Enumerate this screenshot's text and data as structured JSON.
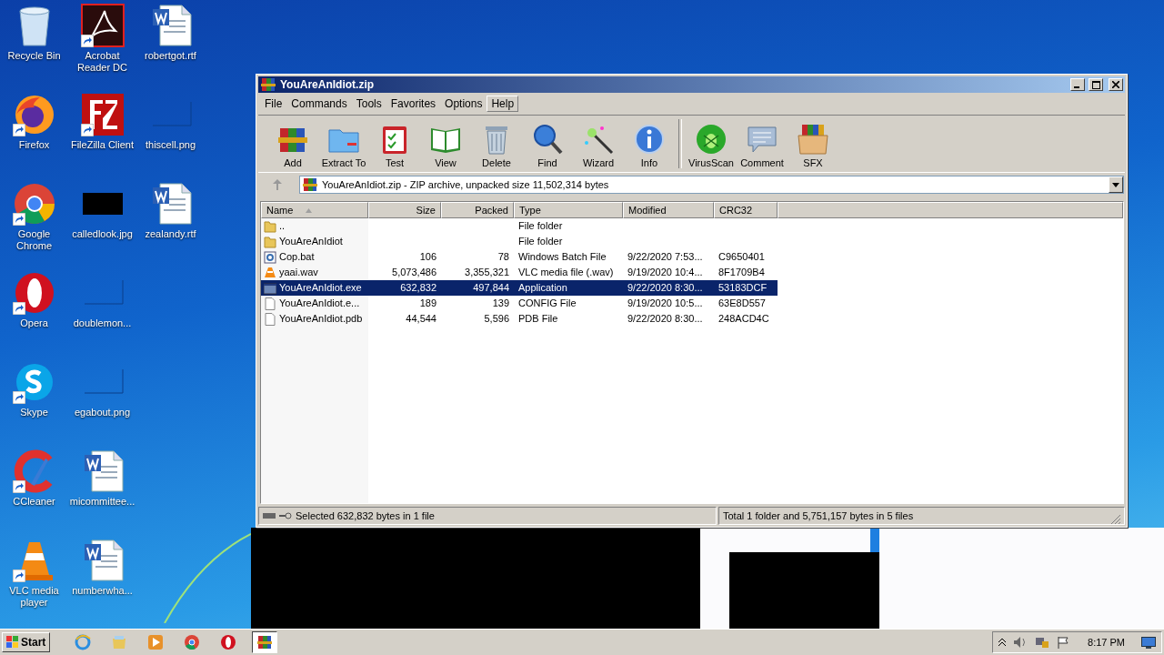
{
  "desktop": {
    "icons": [
      {
        "label": "Recycle Bin",
        "kind": "recycle",
        "shortcut": false
      },
      {
        "label": "Firefox",
        "kind": "firefox",
        "shortcut": true
      },
      {
        "label": "Google Chrome",
        "kind": "chrome",
        "shortcut": true
      },
      {
        "label": "Opera",
        "kind": "opera",
        "shortcut": true
      },
      {
        "label": "Skype",
        "kind": "skype",
        "shortcut": true
      },
      {
        "label": "CCleaner",
        "kind": "ccleaner",
        "shortcut": true
      },
      {
        "label": "VLC media player",
        "kind": "vlc",
        "shortcut": true
      },
      {
        "label": "Acrobat Reader DC",
        "kind": "acrobat",
        "shortcut": true
      },
      {
        "label": "FileZilla Client",
        "kind": "filezilla",
        "shortcut": true
      },
      {
        "label": "calledlook.jpg",
        "kind": "dark-image",
        "shortcut": false
      },
      {
        "label": "doublemon...",
        "kind": "blank-image",
        "shortcut": false
      },
      {
        "label": "egabout.png",
        "kind": "blank-image",
        "shortcut": false
      },
      {
        "label": "micommittee...",
        "kind": "word",
        "shortcut": false
      },
      {
        "label": "numberwha...",
        "kind": "word",
        "shortcut": false
      },
      {
        "label": "robertgot.rtf",
        "kind": "word",
        "shortcut": false
      },
      {
        "label": "thiscell.png",
        "kind": "blank-image",
        "shortcut": false
      },
      {
        "label": "zealandy.rtf",
        "kind": "word",
        "shortcut": false
      }
    ]
  },
  "window": {
    "title": "YouAreAnIdiot.zip",
    "menu": [
      {
        "label": "File",
        "selected": false
      },
      {
        "label": "Commands",
        "selected": false
      },
      {
        "label": "Tools",
        "selected": false
      },
      {
        "label": "Favorites",
        "selected": false
      },
      {
        "label": "Options",
        "selected": false
      },
      {
        "label": "Help",
        "selected": true
      }
    ],
    "toolbar": [
      {
        "kind": "button",
        "label": "Add"
      },
      {
        "kind": "button",
        "label": "Extract To"
      },
      {
        "kind": "button",
        "label": "Test"
      },
      {
        "kind": "button",
        "label": "View"
      },
      {
        "kind": "button",
        "label": "Delete"
      },
      {
        "kind": "button",
        "label": "Find"
      },
      {
        "kind": "button",
        "label": "Wizard"
      },
      {
        "kind": "button",
        "label": "Info"
      },
      {
        "kind": "separator"
      },
      {
        "kind": "button",
        "label": "VirusScan"
      },
      {
        "kind": "button",
        "label": "Comment"
      },
      {
        "kind": "button",
        "label": "SFX"
      }
    ],
    "address": "YouAreAnIdiot.zip - ZIP archive, unpacked size 11,502,314 bytes",
    "table": {
      "columns": [
        "Name",
        "Size",
        "Packed",
        "Type",
        "Modified",
        "CRC32"
      ],
      "rows": [
        {
          "kind": "folder",
          "name": "..",
          "size": "",
          "packed": "",
          "type": "File folder",
          "modified": "",
          "crc": "",
          "selected": false
        },
        {
          "kind": "folder",
          "name": "YouAreAnIdiot",
          "size": "",
          "packed": "",
          "type": "File folder",
          "modified": "",
          "crc": "",
          "selected": false
        },
        {
          "kind": "bat",
          "name": "Cop.bat",
          "size": "106",
          "packed": "78",
          "type": "Windows Batch File",
          "modified": "9/22/2020 7:53...",
          "crc": "C9650401",
          "selected": false
        },
        {
          "kind": "vlc",
          "name": "yaai.wav",
          "size": "5,073,486",
          "packed": "3,355,321",
          "type": "VLC media file (.wav)",
          "modified": "9/19/2020 10:4...",
          "crc": "8F1709B4",
          "selected": false
        },
        {
          "kind": "exe",
          "name": "YouAreAnIdiot.exe",
          "size": "632,832",
          "packed": "497,844",
          "type": "Application",
          "modified": "9/22/2020 8:30...",
          "crc": "53183DCF",
          "selected": true
        },
        {
          "kind": "file",
          "name": "YouAreAnIdiot.e...",
          "size": "189",
          "packed": "139",
          "type": "CONFIG File",
          "modified": "9/19/2020 10:5...",
          "crc": "63E8D557",
          "selected": false
        },
        {
          "kind": "file",
          "name": "YouAreAnIdiot.pdb",
          "size": "44,544",
          "packed": "5,596",
          "type": "PDB File",
          "modified": "9/22/2020 8:30...",
          "crc": "248ACD4C",
          "selected": false
        }
      ]
    },
    "status_bar": {
      "left": "Selected 632,832 bytes in 1 file",
      "right": "Total 1 folder and 5,751,157 bytes in 5 files"
    }
  },
  "taskbar": {
    "start": "Start",
    "apps": [
      {
        "kind": "ie",
        "selected": false
      },
      {
        "kind": "explorer",
        "selected": false
      },
      {
        "kind": "media",
        "selected": false
      },
      {
        "kind": "chrome",
        "selected": false
      },
      {
        "kind": "opera",
        "selected": false
      },
      {
        "kind": "winrar",
        "selected": true
      }
    ],
    "time": "8:17 PM"
  }
}
